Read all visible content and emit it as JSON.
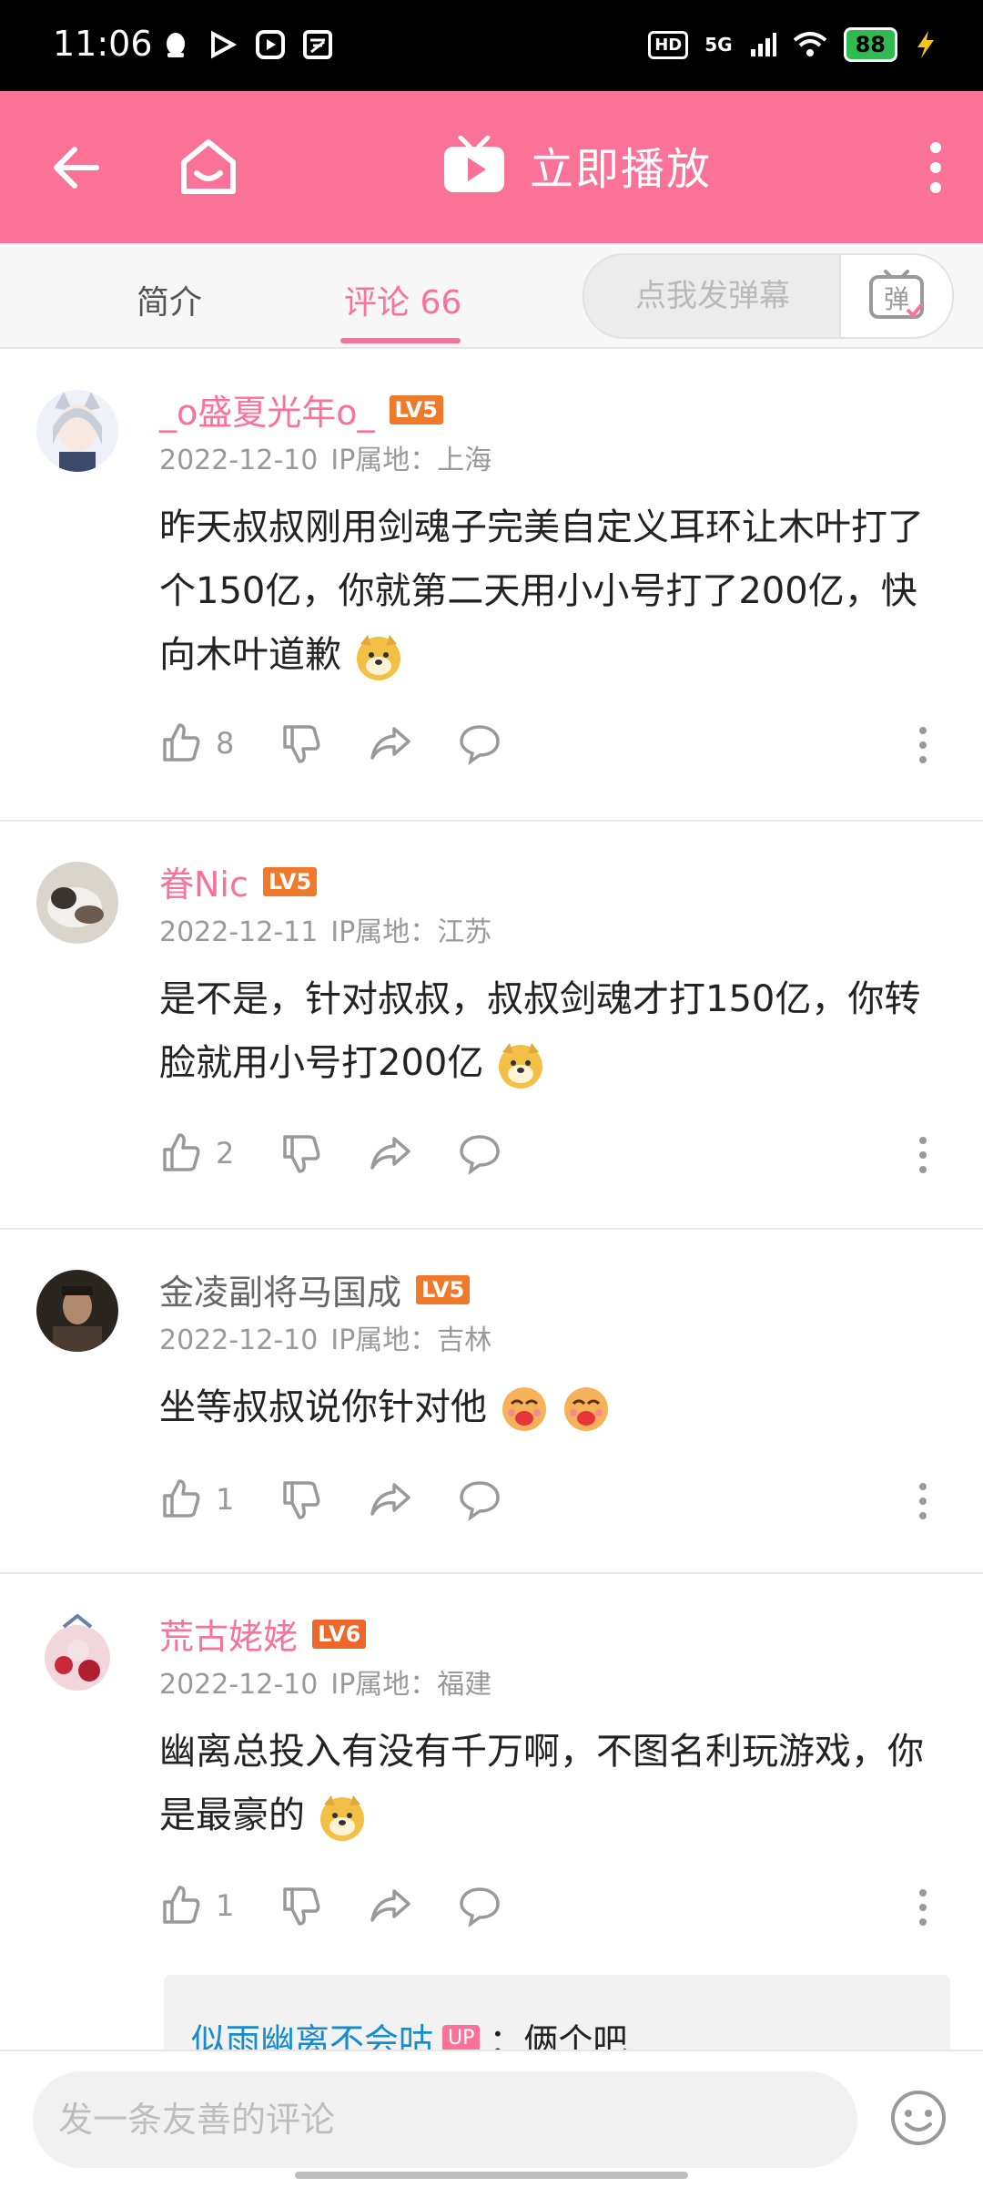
{
  "status": {
    "time": "11:06",
    "battery": "88",
    "network": "5G",
    "hd": "HD"
  },
  "toolbar": {
    "play_label": "立即播放"
  },
  "tabs": {
    "intro": "简介",
    "comments": "评论 66"
  },
  "danmaku": {
    "placeholder": "点我发弹幕",
    "button": "弹"
  },
  "comments": [
    {
      "user": "_o盛夏光年o_",
      "level": "LV5",
      "date": "2022-12-10",
      "ip": "IP属地：上海",
      "text": "昨天叔叔刚用剑魂子完美自定义耳环让木叶打了个150亿，你就第二天用小小号打了200亿，快向木叶道歉",
      "likes": "8"
    },
    {
      "user": "眷Nic",
      "level": "LV5",
      "date": "2022-12-11",
      "ip": "IP属地：江苏",
      "text": "是不是，针对叔叔，叔叔剑魂才打150亿，你转脸就用小号打200亿",
      "likes": "2"
    },
    {
      "user": "金凌副将马国成",
      "level": "LV5",
      "date": "2022-12-10",
      "ip": "IP属地：吉林",
      "text": "坐等叔叔说你针对他",
      "likes": "1"
    },
    {
      "user": "荒古姥姥",
      "level": "LV6",
      "date": "2022-12-10",
      "ip": "IP属地：福建",
      "text": "幽离总投入有没有千万啊，不图名利玩游戏，你是最豪的",
      "likes": "1"
    }
  ],
  "reply": {
    "user": "似雨幽离不会咕",
    "tag": "UP",
    "text": "：俩个吧"
  },
  "bottom": {
    "placeholder": "发一条友善的评论"
  },
  "colors": {
    "brand": "#fb7299",
    "level": "#f07a2b",
    "reply_link": "#178bcf"
  }
}
